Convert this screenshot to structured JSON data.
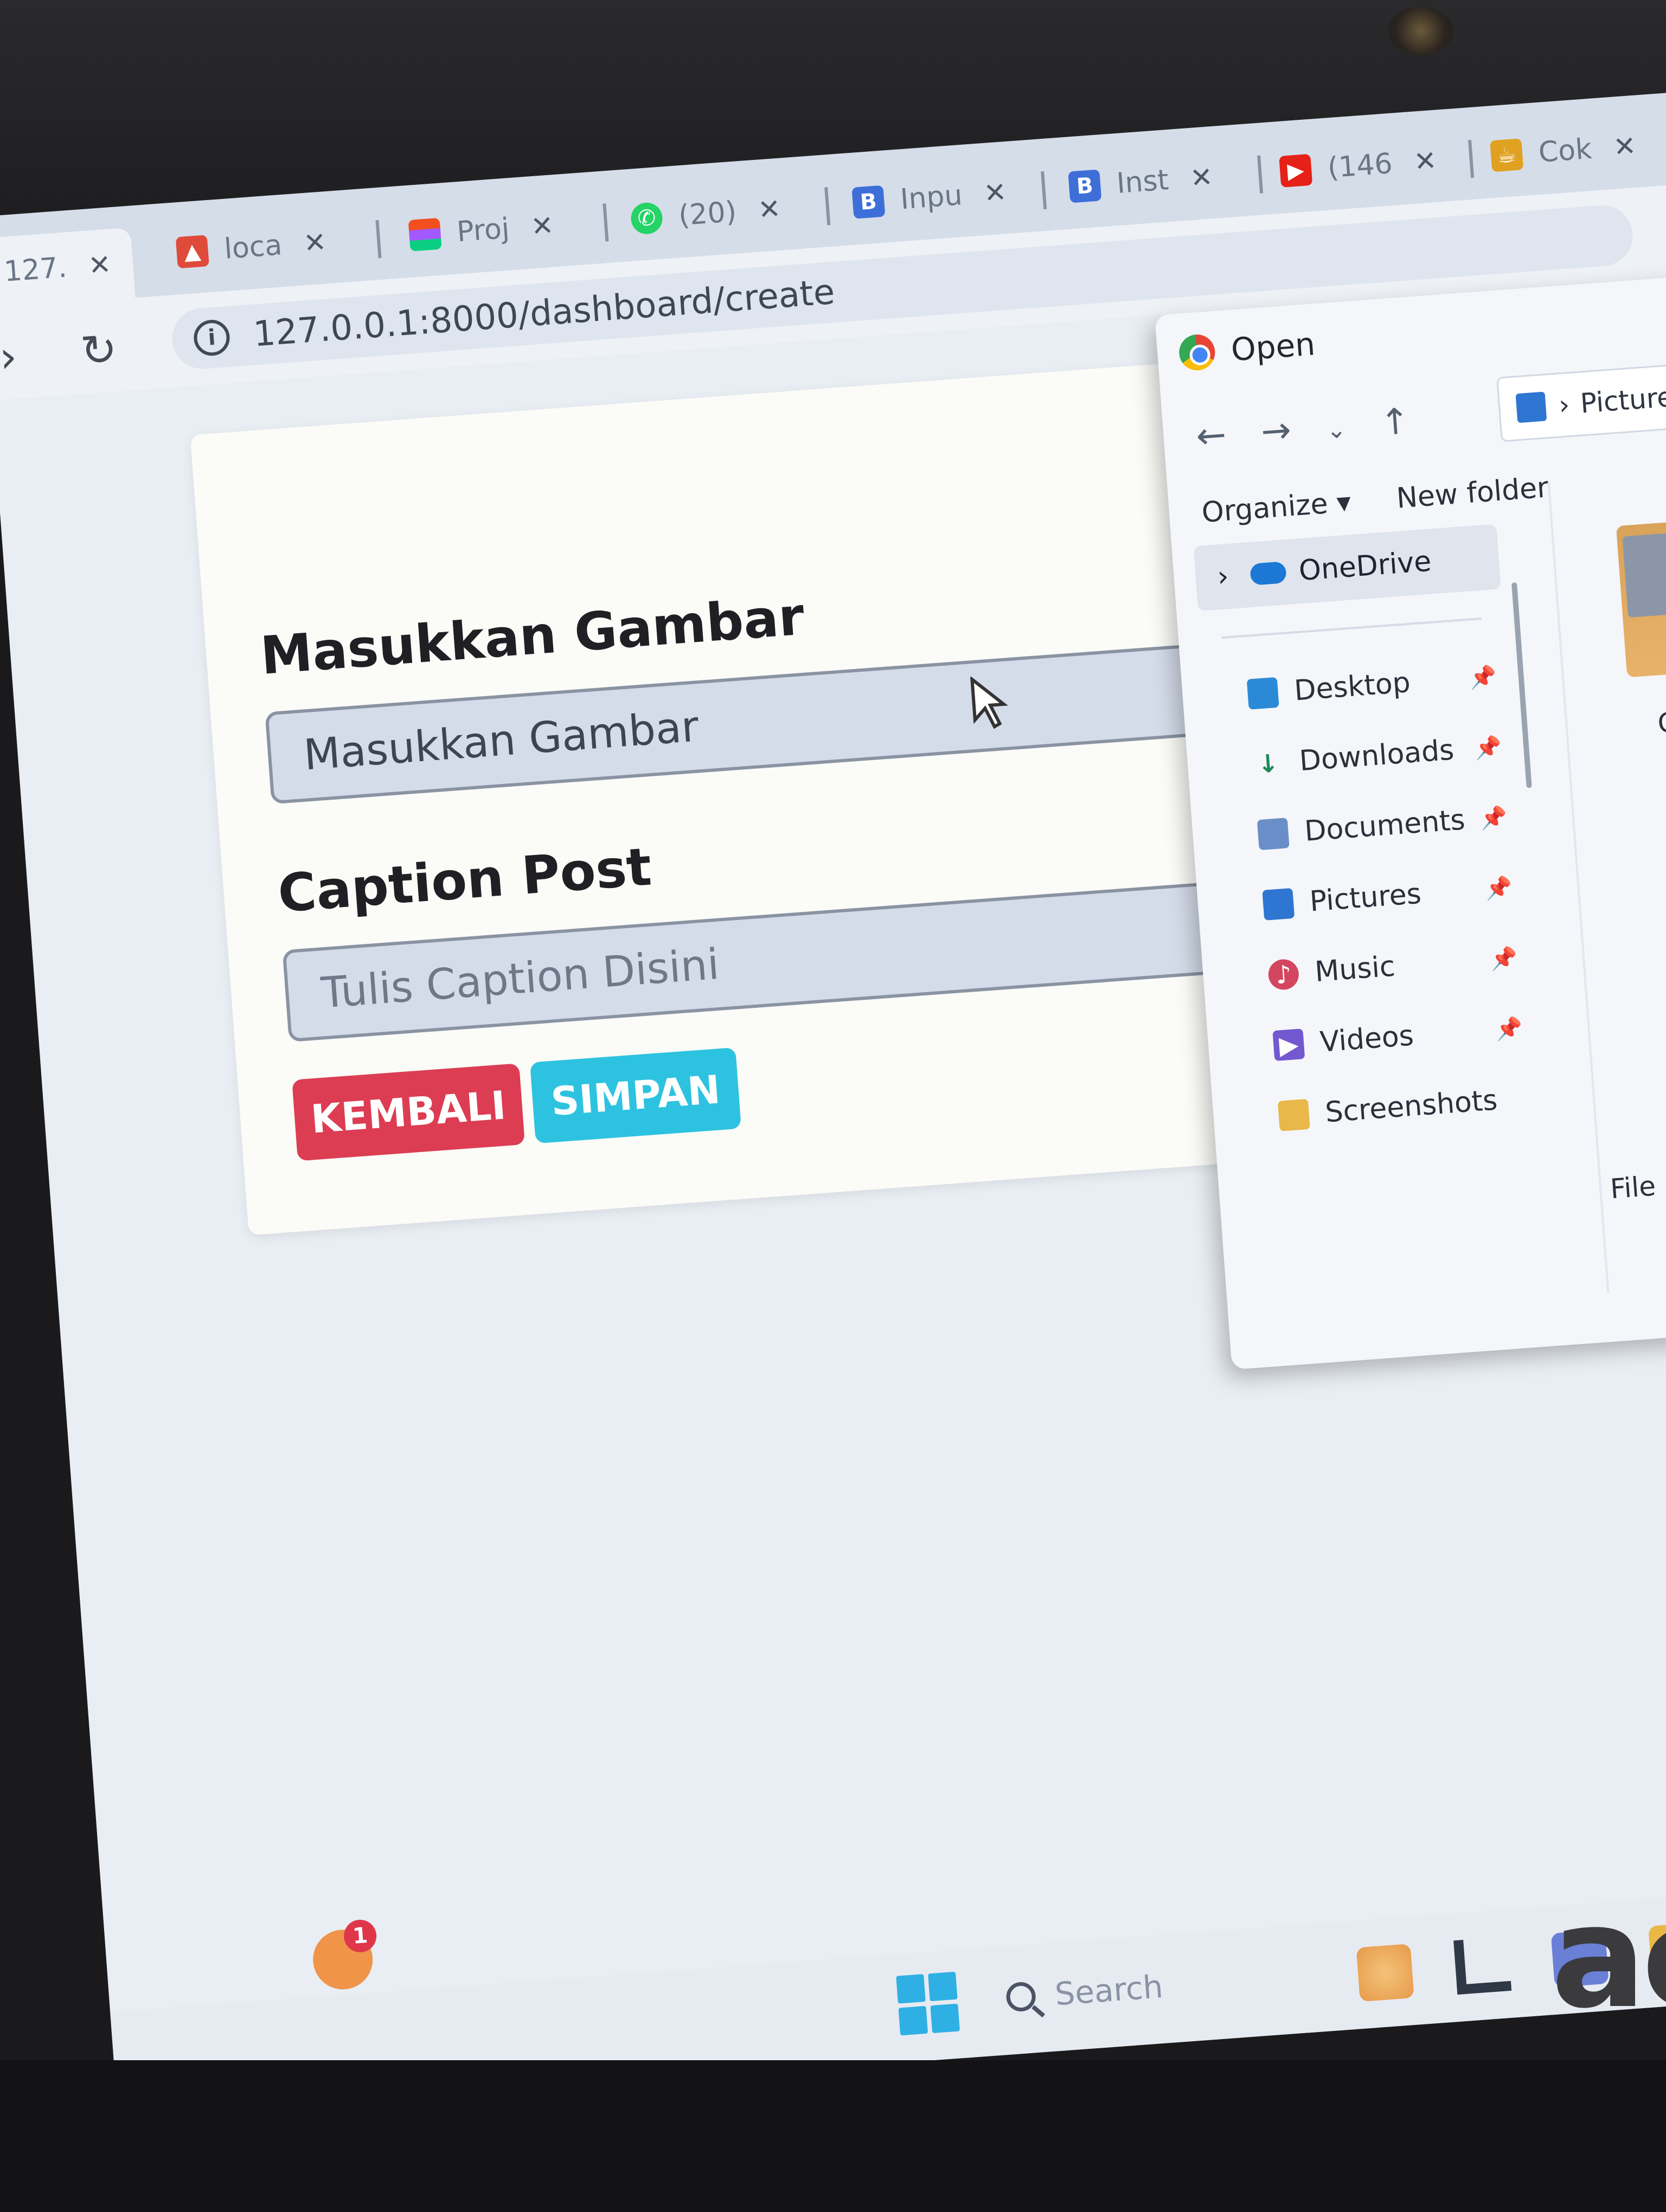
{
  "browser": {
    "tabs": [
      {
        "label": "127.",
        "active": true
      },
      {
        "label": "loca"
      },
      {
        "label": "Proj"
      },
      {
        "label": "(20)"
      },
      {
        "label": "Inpu"
      },
      {
        "label": "Inst"
      },
      {
        "label": "(146"
      },
      {
        "label": "Cok"
      }
    ],
    "url": "127.0.0.1:8000/dashboard/create"
  },
  "form": {
    "image_label": "Masukkan Gambar",
    "image_placeholder": "Masukkan Gambar",
    "caption_label": "Caption Post",
    "caption_placeholder": "Tulis Caption Disini",
    "back_button": "KEMBALI",
    "save_button": "SIMPAN",
    "colors": {
      "back": "#dc3d52",
      "save": "#2dc3e0"
    }
  },
  "dialog": {
    "title": "Open",
    "path": "Pictures",
    "organize": "Organize ▾",
    "new_folder": "New folder",
    "onedrive": "OneDrive",
    "quick_access": [
      {
        "label": "Desktop",
        "icon": "desktop-icon"
      },
      {
        "label": "Downloads",
        "icon": "download-icon"
      },
      {
        "label": "Documents",
        "icon": "document-icon"
      },
      {
        "label": "Pictures",
        "icon": "pictures-icon"
      },
      {
        "label": "Music",
        "icon": "music-icon"
      },
      {
        "label": "Videos",
        "icon": "videos-icon"
      },
      {
        "label": "Screenshots",
        "icon": "folder-icon"
      }
    ],
    "file_label": "Car",
    "file_name_label": "File name:"
  },
  "taskbar": {
    "search_placeholder": "Search",
    "notification_count": "1"
  },
  "laptop": {
    "brand": "ac"
  }
}
